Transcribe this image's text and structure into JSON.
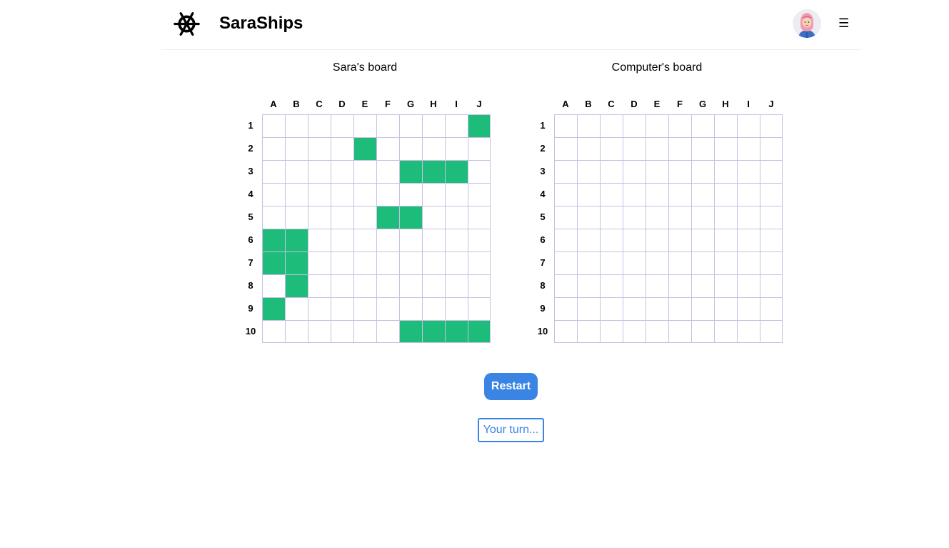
{
  "app": {
    "title": "SaraShips"
  },
  "icons": {
    "logo": "ship-wheel-icon",
    "avatar": "user-avatar-hijab",
    "menu": "☰"
  },
  "colors": {
    "ship": "#1dbc7a",
    "accent": "#3a84e3",
    "grid_line": "#c7c0df"
  },
  "columns": [
    "A",
    "B",
    "C",
    "D",
    "E",
    "F",
    "G",
    "H",
    "I",
    "J"
  ],
  "rows": [
    "1",
    "2",
    "3",
    "4",
    "5",
    "6",
    "7",
    "8",
    "9",
    "10"
  ],
  "boards": [
    {
      "title": "Sara's board",
      "ships": [
        "J1",
        "E2",
        "G3",
        "H3",
        "I3",
        "F5",
        "G5",
        "A6",
        "B6",
        "A7",
        "B7",
        "B8",
        "A9",
        "G10",
        "H10",
        "I10",
        "J10"
      ]
    },
    {
      "title": "Computer's board",
      "ships": []
    }
  ],
  "controls": {
    "restart_label": "Restart",
    "status": "Your turn..."
  }
}
